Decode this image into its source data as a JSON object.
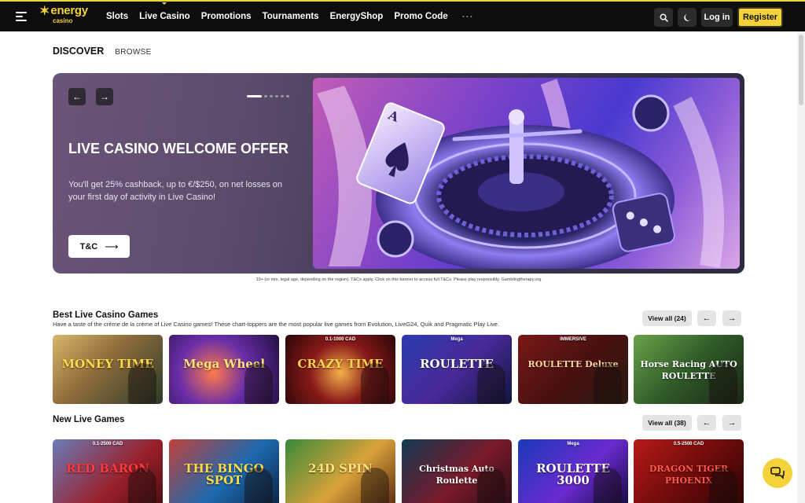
{
  "header": {
    "logo_main": "energy",
    "logo_sub": "casino",
    "nav": [
      "Slots",
      "Live Casino",
      "Promotions",
      "Tournaments",
      "EnergyShop",
      "Promo Code"
    ],
    "more": "···",
    "login": "Log in",
    "register": "Register"
  },
  "tabs": {
    "discover": "DISCOVER",
    "browse": "BROWSE"
  },
  "hero": {
    "title": "LIVE CASINO WELCOME OFFER",
    "description": "You'll get 25% cashback, up to €/$250, on net losses on your first day of activity in Live Casino!",
    "cta": "T&C",
    "prev_icon": "←",
    "next_icon": "→",
    "dots_total": 6,
    "active_dot": 1
  },
  "disclaimer": "19+ (or min. legal age, depending on the region). T&Cs apply. Click on this banner to access full T&Cs. Please play responsibly. Gamblingtherapy.org",
  "best": {
    "title": "Best Live Casino Games",
    "subtitle": "Have a taste of the crème de la crème of Live Casino games! These chart-toppers are the most popular live games from Evolution, LiveG24, Quik and Pragmatic Play Live.",
    "view_all": "View all (24)",
    "games": [
      {
        "label": "MONEY TIME",
        "top": ""
      },
      {
        "label": "Mega Wheel",
        "top": ""
      },
      {
        "label": "CRAZY TIME",
        "top": "0.1-1000 CAD"
      },
      {
        "label": "ROULETTE",
        "top": "Mega"
      },
      {
        "label": "ROULETTE Deluxe",
        "top": "IMMERSIVE"
      },
      {
        "label": "Horse Racing AUTO ROULETTE",
        "top": ""
      }
    ]
  },
  "new_games": {
    "title": "New Live Games",
    "view_all": "View all (38)",
    "games": [
      {
        "label": "RED BARON",
        "top": "0.1-2500 CAD"
      },
      {
        "label": "THE BINGO SPOT",
        "top": ""
      },
      {
        "label": "24D SPIN",
        "top": ""
      },
      {
        "label": "Christmas Auto Roulette",
        "top": ""
      },
      {
        "label": "ROULETTE 3000",
        "top": "Mega"
      },
      {
        "label": "DRAGON TIGER PHOENIX",
        "top": "0.5-2500 CAD"
      }
    ]
  },
  "colors": {
    "accent": "#f3d23a",
    "header_bg": "#0d0d0d"
  }
}
